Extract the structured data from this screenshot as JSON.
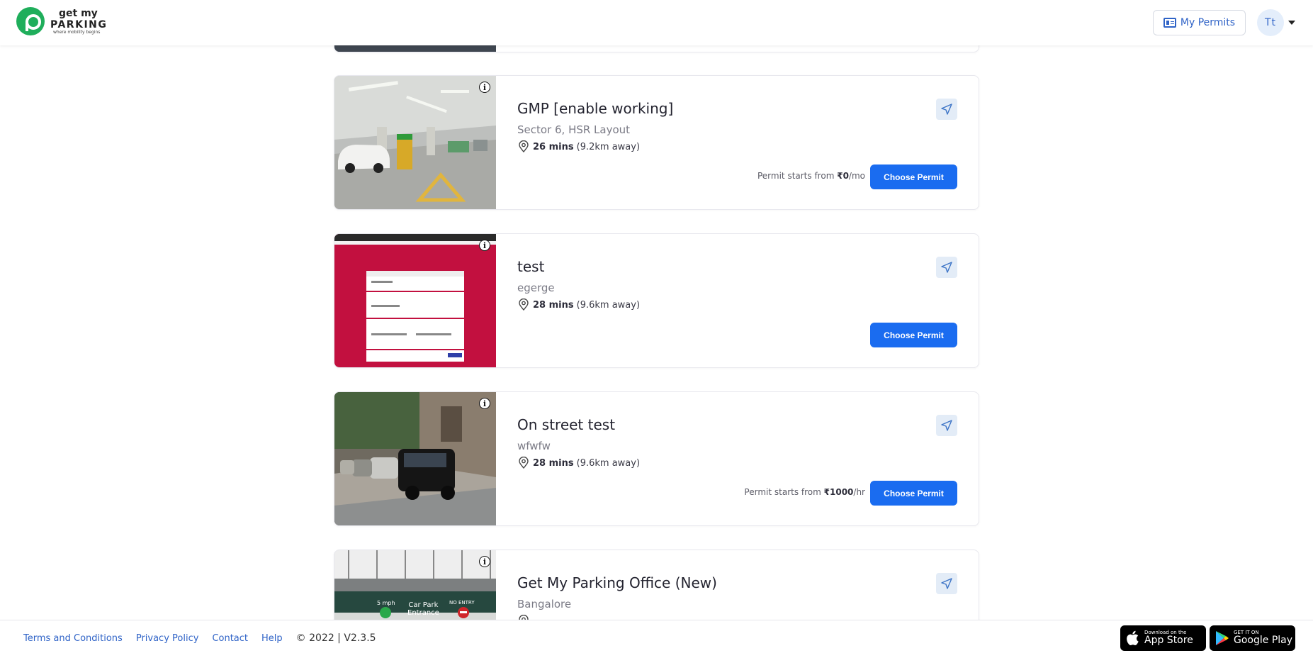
{
  "header": {
    "logo": {
      "line1": "get my",
      "line2": "PARKING",
      "tagline": "where mobility begins"
    },
    "my_permits_label": "My Permits",
    "avatar_initials": "Tt"
  },
  "cards": [
    {
      "title": "GMP [enable working]",
      "subtitle": "Sector 6, HSR Layout",
      "duration": "26 mins",
      "distance": "(9.2km away)",
      "permit_prefix": "Permit starts from",
      "permit_price": "₹0",
      "permit_unit": "/mo",
      "button_label": "Choose Permit"
    },
    {
      "title": "test",
      "subtitle": "egerge",
      "duration": "28 mins",
      "distance": "(9.6km away)",
      "button_label": "Choose Permit"
    },
    {
      "title": "On street test",
      "subtitle": "wfwfw",
      "duration": "28 mins",
      "distance": "(9.6km away)",
      "permit_prefix": "Permit starts from",
      "permit_price": "₹1000",
      "permit_unit": "/hr",
      "button_label": "Choose Permit"
    },
    {
      "title": "Get My Parking Office (New)",
      "subtitle": "Bangalore",
      "image_sign": {
        "speed": "5 mph",
        "entrance_l1": "Car Park",
        "entrance_l2": "Entrance",
        "no_entry": "NO ENTRY"
      }
    }
  ],
  "footer": {
    "links": [
      "Terms and Conditions",
      "Privacy Policy",
      "Contact",
      "Help"
    ],
    "copyright": "© 2022 | V2.3.5",
    "app_store": {
      "small": "Download on the",
      "big": "App Store"
    },
    "google_play": {
      "small": "GET IT ON",
      "big": "Google Play"
    }
  },
  "colors": {
    "accent": "#1a6cf0",
    "brand": "#1fae5b",
    "link": "#2f63c7"
  }
}
